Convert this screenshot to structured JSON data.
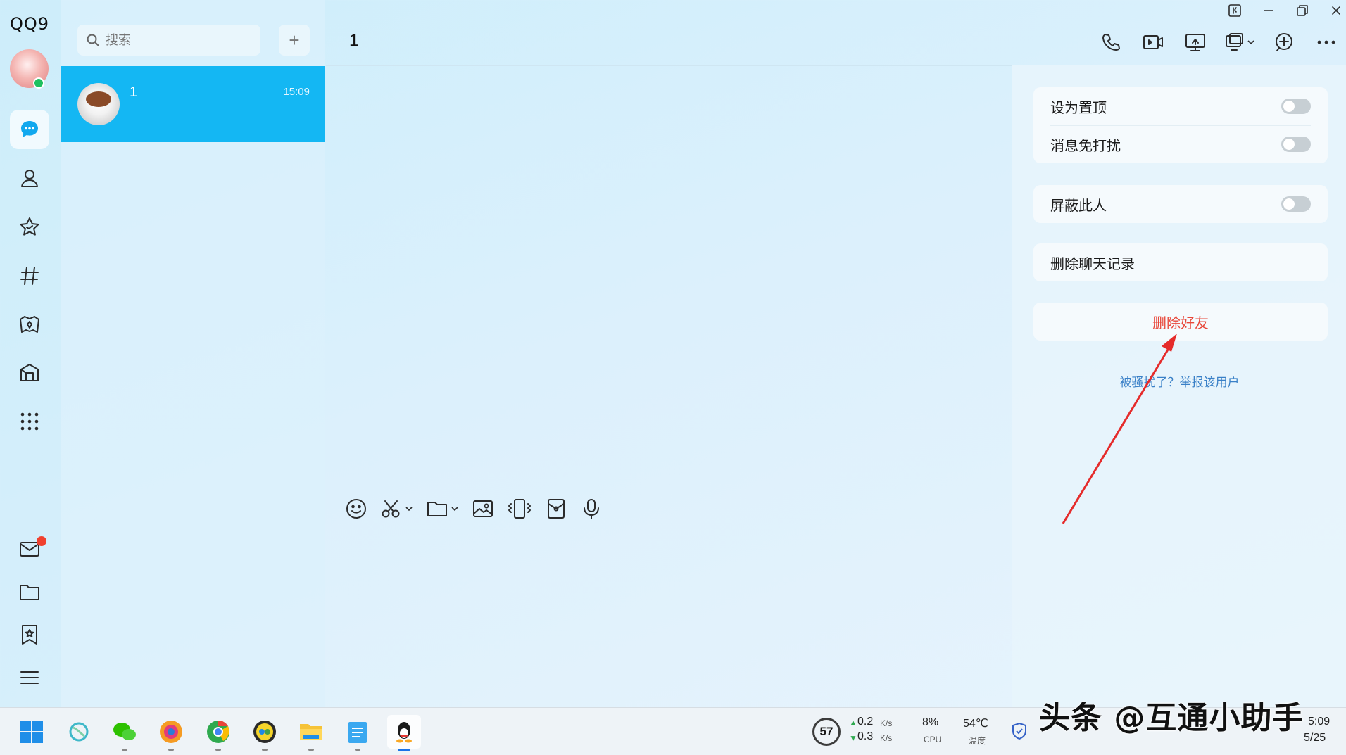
{
  "app": {
    "logo": "QQ9"
  },
  "nav": {
    "items": [
      "chat-icon",
      "contacts-icon",
      "favorites-icon",
      "channels-icon",
      "games-icon",
      "store-icon",
      "apps-grid-icon"
    ],
    "bottom": [
      "mail-icon",
      "folder-icon",
      "bookmark-icon",
      "menu-icon"
    ],
    "mail_badge_color": "#f0402e"
  },
  "convlist": {
    "search_placeholder": "搜索",
    "add_label": "+",
    "items": [
      {
        "name": "1",
        "time": "15:09",
        "selected": true
      }
    ],
    "selected_color": "#14b7f3"
  },
  "chat": {
    "title": "1",
    "window_controls": [
      "pin-icon",
      "minimize-icon",
      "restore-icon",
      "close-icon"
    ],
    "header_tools": [
      "voice-call-icon",
      "video-call-icon",
      "screen-share-icon",
      "remote-assist-icon",
      "add-member-icon",
      "more-icon"
    ],
    "input_tools": [
      "emoji-icon",
      "screenshot-icon",
      "file-icon",
      "image-icon",
      "shake-icon",
      "red-packet-icon",
      "voice-message-icon"
    ]
  },
  "settings": {
    "pin_top": "设为置顶",
    "mute": "消息免打扰",
    "block": "屏蔽此人",
    "delete_history": "删除聊天记录",
    "delete_friend": "删除好友",
    "report": "被骚扰了？举报该用户",
    "delete_color": "#e8483b",
    "link_color": "#3a80c7"
  },
  "taskbar": {
    "apps": [
      "windows-start-icon",
      "copilot-icon",
      "wechat-icon",
      "browser-icon",
      "chrome-icon",
      "music-icon",
      "file-explorer-icon",
      "notepad-icon",
      "qq-icon"
    ],
    "cpu_score": "57",
    "net_up": "0.2",
    "net_down": "0.3",
    "net_unit": "K/s",
    "cpu_percent": "8%",
    "cpu_label": "CPU",
    "temperature": "54℃",
    "temperature_label": "温度",
    "clock_time": "5:09",
    "clock_date": "5/25",
    "watermark": "头条 @互通小助手"
  }
}
